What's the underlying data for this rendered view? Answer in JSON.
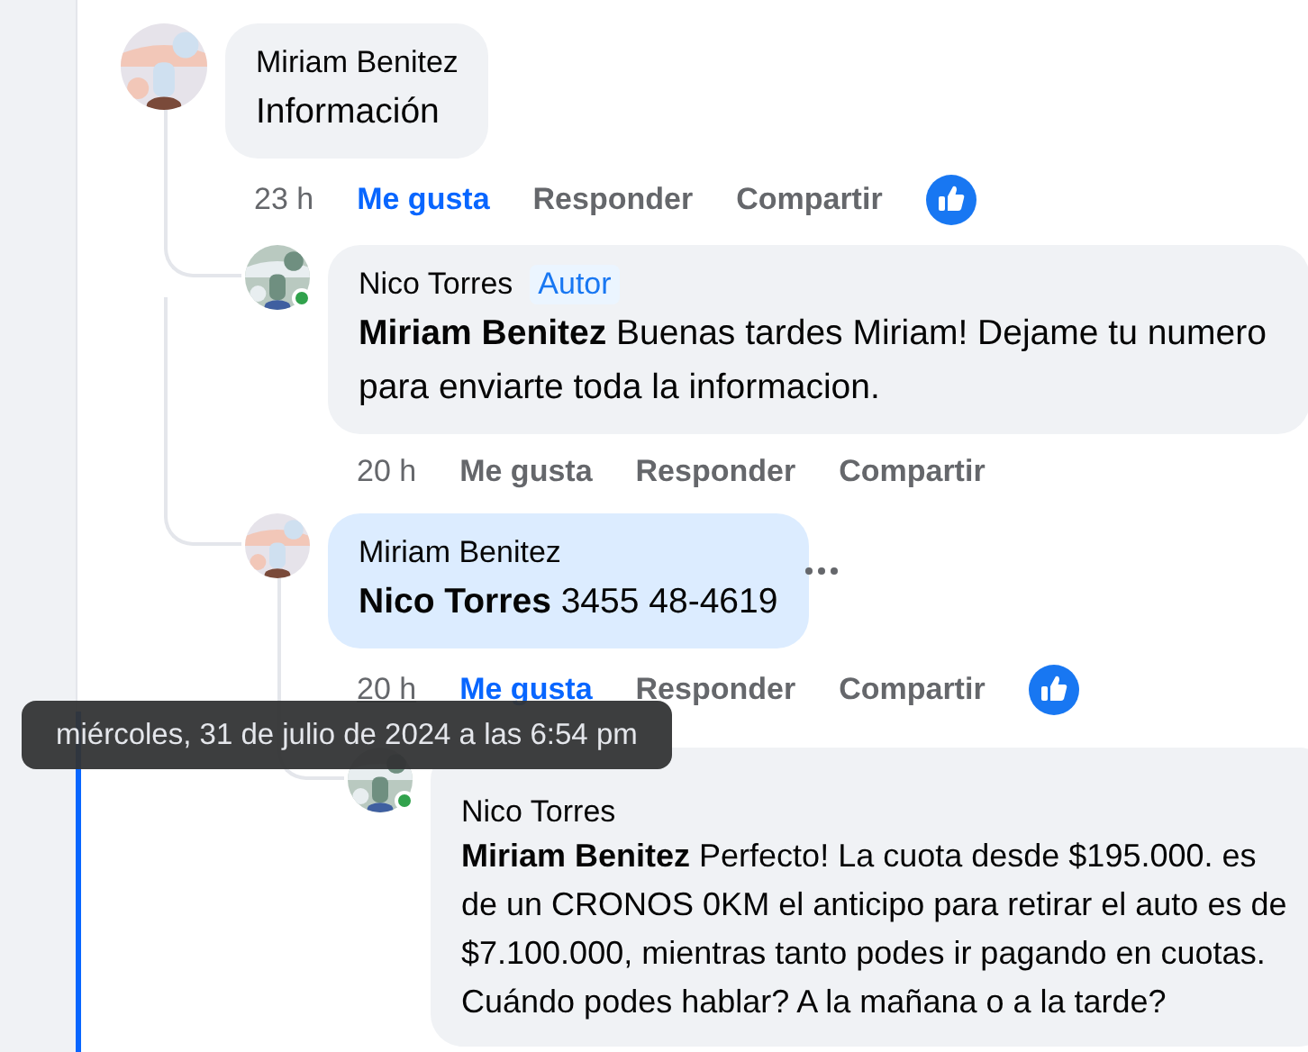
{
  "comments": [
    {
      "author": "Miriam Benitez",
      "text": "Información",
      "time": "23 h",
      "liked": true,
      "reaction": true,
      "actions": [
        "Me gusta",
        "Responder",
        "Compartir"
      ],
      "children": [
        {
          "author": "Nico Torres",
          "badge": "Autor",
          "mention": "Miriam Benitez",
          "text": "Buenas tardes Miriam! Dejame tu numero para enviarte toda la informacion.",
          "time": "20 h",
          "liked": false,
          "online": true,
          "actions": [
            "Me gusta",
            "Responder",
            "Compartir"
          ]
        },
        {
          "author": "Miriam Benitez",
          "mention": "Nico Torres",
          "text": "3455 48-4619",
          "time": "20 h",
          "time_hovered": true,
          "liked": true,
          "reaction": true,
          "highlighted": true,
          "show_menu": true,
          "actions": [
            "Me gusta",
            "Responder",
            "Compartir"
          ],
          "children": [
            {
              "author": "Nico Torres",
              "mention": "Miriam Benitez",
              "text": "Perfecto! La cuota desde $195.000. es de un CRONOS 0KM el anticipo para retirar el auto es de $7.100.000, mientras tanto podes ir pagando en cuotas. Cuándo podes hablar? A la mañana o a la tarde?",
              "online": true
            }
          ]
        }
      ]
    }
  ],
  "tooltip": {
    "text": "miércoles, 31 de julio de 2024 a las 6:54 pm"
  }
}
